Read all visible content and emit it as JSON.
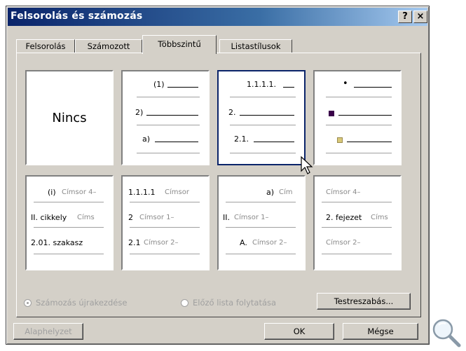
{
  "window": {
    "title": "Felsorolás és számozás",
    "help_glyph": "?",
    "close_glyph": "×"
  },
  "tabs": [
    "Felsorolás",
    "Számozott",
    "Többszintű",
    "Listastílusok"
  ],
  "active_tab": "Többszintű",
  "cells": {
    "c0": {
      "text": "Nincs"
    },
    "c1": {
      "l1": "(1)",
      "l2": "2)",
      "l3": "a)"
    },
    "c2": {
      "l1": "1.1.1.1.",
      "l2": "2.",
      "l3": "2.1."
    },
    "c3": {
      "bullet": "•",
      "sq_colors": [
        "#3a004a",
        "#d8c878"
      ]
    },
    "c4": {
      "l1a": "(i)",
      "l1b": "Címsor 4–",
      "l2a": "II. cikkely",
      "l2b": "Címs",
      "l3": "2.01. szakasz"
    },
    "c5": {
      "l1a": "1.1.1.1",
      "l1b": "Címsor",
      "l2a": "2",
      "l2b": "Címsor 1–",
      "l3a": "2.1",
      "l3b": "Címsor 2–"
    },
    "c6": {
      "l1a": "a)",
      "l1b": "Cím",
      "l2a": "II.",
      "l2b": "Címsor 1–",
      "l3a": "A.",
      "l3b": "Címsor 2–"
    },
    "c7": {
      "l1": "Címsor 4–",
      "l2a": "2. fejezet",
      "l2b": "Címs",
      "l3": "Címsor 2–"
    }
  },
  "options": {
    "restart": "Számozás újrakezdése",
    "continue": "Előző lista folytatása"
  },
  "buttons": {
    "customize": "Testreszabás...",
    "reset": "Alaphelyzet",
    "ok": "OK",
    "cancel": "Mégse"
  },
  "colors": {
    "selection": "#0a246a",
    "title_gradient_start": "#0a246a"
  }
}
